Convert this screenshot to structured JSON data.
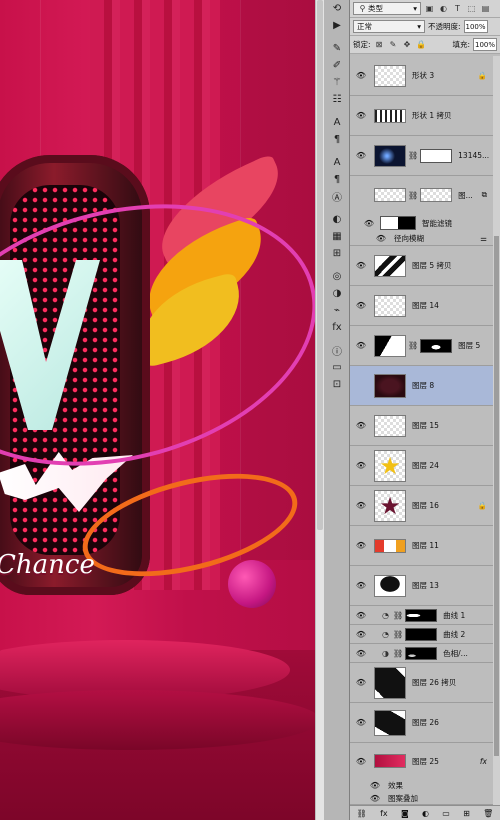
{
  "options_bar": {
    "filter_label": "类型",
    "blend_mode": "正常",
    "opacity_label": "不透明度:",
    "opacity_value": "100%",
    "lock_label": "锁定:",
    "fill_label": "填充:",
    "fill_value": "100%"
  },
  "canvas": {
    "chance_text": "Chance"
  },
  "layers": [
    {
      "name": "形状 3",
      "badge": "🔒"
    },
    {
      "name": "形状 1 拷贝",
      "badge": ""
    },
    {
      "name": "13145...",
      "badge": ""
    },
    {
      "name": "图...",
      "badge": "⧉"
    },
    {
      "name": "智能滤镜",
      "badge": ""
    },
    {
      "name": "径向模糊",
      "badge": "⚌"
    },
    {
      "name": "图层 5 拷贝",
      "badge": ""
    },
    {
      "name": "图层 14",
      "badge": ""
    },
    {
      "name": "图层 5",
      "badge": ""
    },
    {
      "name": "图层 8",
      "badge": ""
    },
    {
      "name": "图层 15",
      "badge": ""
    },
    {
      "name": "图层 24",
      "badge": ""
    },
    {
      "name": "图层 16",
      "badge": "🔒"
    },
    {
      "name": "图层 11",
      "badge": ""
    },
    {
      "name": "图层 13",
      "badge": ""
    },
    {
      "name": "曲线 1",
      "badge": ""
    },
    {
      "name": "曲线 2",
      "badge": ""
    },
    {
      "name": "色相/...",
      "badge": ""
    },
    {
      "name": "图层 26 拷贝",
      "badge": ""
    },
    {
      "name": "图层 26",
      "badge": ""
    },
    {
      "name": "图层 25",
      "badge": "fx"
    },
    {
      "name": "效果",
      "badge": ""
    },
    {
      "name": "图案叠加",
      "badge": ""
    }
  ],
  "colors": {
    "selected_row": "#a9b8d8",
    "canvas_red": "#c8114a"
  },
  "icons": {
    "eye": "eye-icon",
    "lock": "lock-icon",
    "link": "chain-link-icon"
  }
}
